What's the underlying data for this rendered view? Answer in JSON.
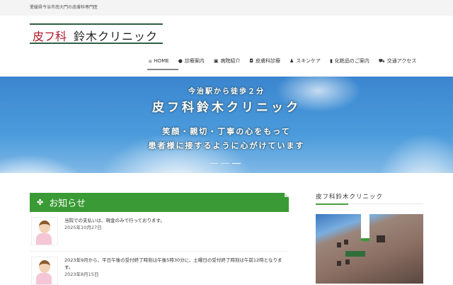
{
  "topbar": {
    "tagline": "愛媛県今治市南大門の皮膚科専門医"
  },
  "logo": {
    "red": "皮フ科",
    "black": "鈴木クリニック"
  },
  "nav": [
    {
      "label": "HOME",
      "icon": "home-icon",
      "glyph": "⌂"
    },
    {
      "label": "診療案内",
      "icon": "info-icon",
      "glyph": "●"
    },
    {
      "label": "病院紹介",
      "icon": "hospital-icon",
      "glyph": "▣"
    },
    {
      "label": "皮膚科診療",
      "icon": "chat-icon",
      "glyph": "◘"
    },
    {
      "label": "スキンケア",
      "icon": "user-icon",
      "glyph": "♟"
    },
    {
      "label": "化粧品のご案内",
      "icon": "bottle-icon",
      "glyph": "▮"
    },
    {
      "label": "交通アクセス",
      "icon": "car-icon",
      "glyph": "⛟"
    }
  ],
  "hero": {
    "line1": "今治駅から徒歩２分",
    "line2": "皮フ科鈴木クリニック",
    "line3": "笑顔・親切・丁寧の心をもって",
    "line4": "患者様に接するように心がけています"
  },
  "notices": {
    "title": "お知らせ",
    "items": [
      {
        "text": "当院での支払いは、現金のみで行っております。",
        "date": "2025年10月27日"
      },
      {
        "text": "2023年9月から、平日午後の受付終了時刻は午後5時30分に、土曜日の受付終了時刻は午前12時となります。",
        "date": "2023年8月15日"
      }
    ]
  },
  "sidebar": {
    "title": "皮フ科鈴木クリニック"
  }
}
